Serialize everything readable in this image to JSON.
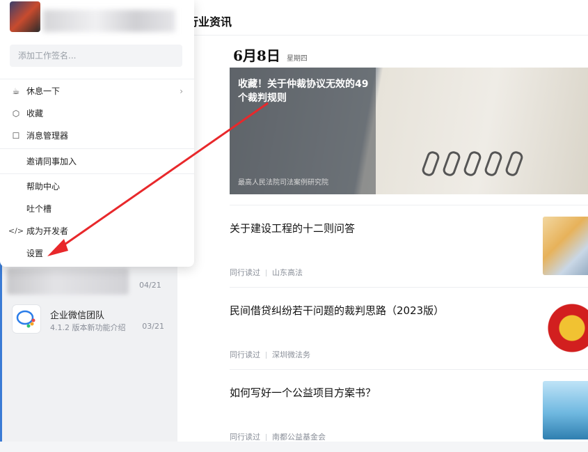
{
  "sidebar": {
    "conversations": [
      {
        "title": "",
        "subtitle": "",
        "time": "04/21"
      },
      {
        "title": "企业微信团队",
        "subtitle": "4.1.2 版本新功能介绍",
        "time": "03/21"
      }
    ]
  },
  "main": {
    "header_title": "行业资讯",
    "date": "6月8日",
    "weekday": "星期四",
    "feature": {
      "title": "收藏！关于仲裁协议无效的49个裁判规则",
      "source": "最高人民法院司法案例研究院"
    },
    "articles": [
      {
        "title": "关于建设工程的十二则问答",
        "tag": "同行读过",
        "source": "山东高法"
      },
      {
        "title": "民间借贷纠纷若干问题的裁判思路（2023版）",
        "tag": "同行读过",
        "source": "深圳微法务"
      },
      {
        "title": "如何写好一个公益项目方案书？",
        "tag": "同行读过",
        "source": "南都公益基金会"
      }
    ]
  },
  "popup": {
    "signature_placeholder": "添加工作签名...",
    "items": [
      {
        "label": "休息一下",
        "icon": "coffee-icon",
        "glyph": "☕"
      },
      {
        "label": "收藏",
        "icon": "cube-icon",
        "glyph": "⬡"
      },
      {
        "label": "消息管理器",
        "icon": "message-box-icon",
        "glyph": "☐"
      },
      {
        "label": "邀请同事加入"
      },
      {
        "label": "帮助中心"
      },
      {
        "label": "吐个槽"
      },
      {
        "label": "成为开发者",
        "icon": "code-icon",
        "glyph": "</>"
      },
      {
        "label": "设置"
      }
    ]
  },
  "colors": {
    "annotation_arrow": "#e8282b",
    "accent": "#3a7bd5"
  }
}
